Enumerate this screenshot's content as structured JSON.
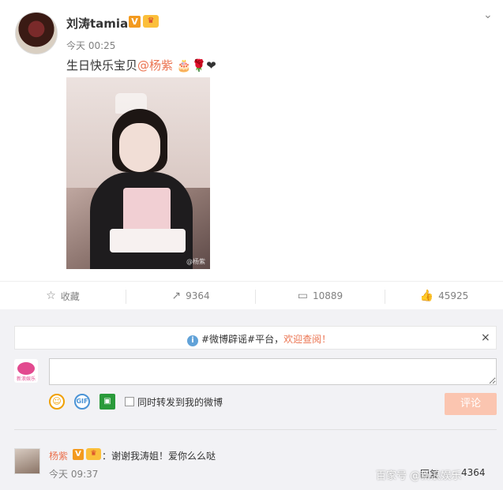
{
  "post": {
    "username": "刘涛tamia",
    "verified_badge": "V",
    "member_badge": "♛",
    "time": "今天 00:25",
    "text_prefix": "生日快乐宝贝",
    "mention": "@杨紫",
    "emojis": "🎂🌹❤",
    "photo_watermark": "@杨紫",
    "menu_icon": "chevron-down-icon"
  },
  "actions": {
    "favorite": {
      "label": "收藏",
      "icon": "☆"
    },
    "repost": {
      "count": "9364",
      "icon": "↗"
    },
    "comment": {
      "count": "10889",
      "icon": "▭"
    },
    "like": {
      "count": "45925",
      "icon": "👍"
    }
  },
  "notice": {
    "info_icon": "i",
    "text": "#微博辟谣#平台，",
    "link": "欢迎查阅！",
    "close": "×"
  },
  "compose": {
    "avatar_label": "新浪娱乐",
    "input_placeholder": "",
    "repost_checkbox_label": "同时转发到我的微博",
    "submit_label": "评论"
  },
  "comment": {
    "username": "杨紫",
    "verified_badge": "V",
    "member_badge": "♛",
    "text": "：谢谢我涛姐！爱你么么哒",
    "time": "今天 09:37",
    "reply_label": "回复",
    "like_count": "4364",
    "overlay_watermark": "百家号 @新浪娱乐"
  },
  "colors": {
    "accent": "#eb7350",
    "submit_bg": "#fbc5b0",
    "badge": "#f39a1f",
    "panel_bg": "#f2f2f5"
  }
}
